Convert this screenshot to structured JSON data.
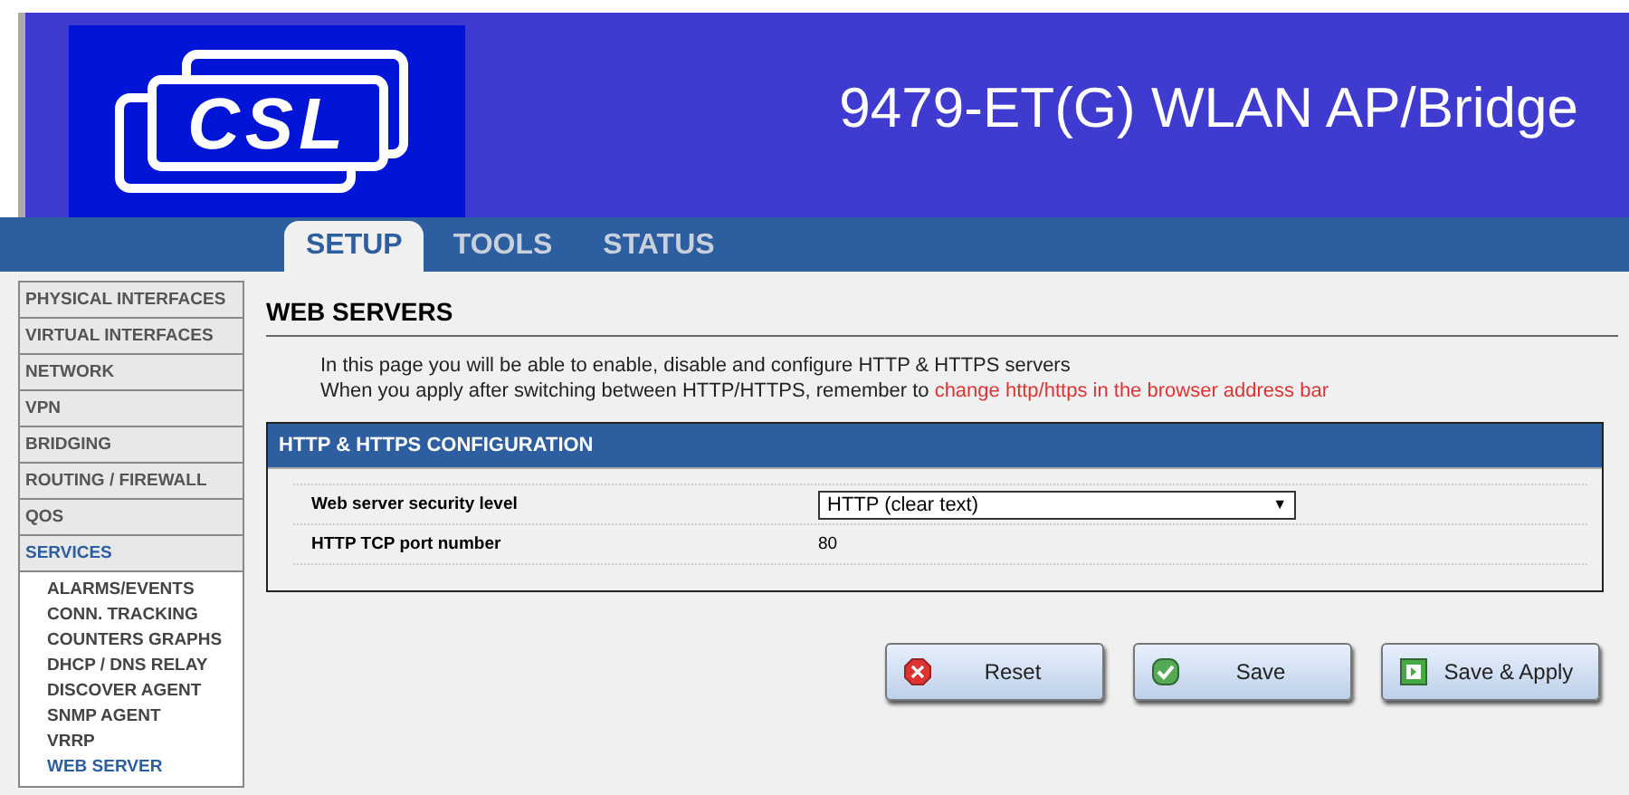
{
  "header": {
    "logo": "CSL",
    "title": "9479-ET(G) WLAN AP/Bridge"
  },
  "tabs": [
    {
      "label": "SETUP",
      "selected": true
    },
    {
      "label": "TOOLS",
      "selected": false
    },
    {
      "label": "STATUS",
      "selected": false
    }
  ],
  "sidebar": {
    "items": [
      {
        "label": "PHYSICAL INTERFACES",
        "selected": false
      },
      {
        "label": "VIRTUAL INTERFACES",
        "selected": false
      },
      {
        "label": "NETWORK",
        "selected": false
      },
      {
        "label": "VPN",
        "selected": false
      },
      {
        "label": "BRIDGING",
        "selected": false
      },
      {
        "label": "ROUTING / FIREWALL",
        "selected": false
      },
      {
        "label": "QOS",
        "selected": false
      },
      {
        "label": "SERVICES",
        "selected": true,
        "children": [
          {
            "label": "ALARMS/EVENTS",
            "selected": false
          },
          {
            "label": "CONN. TRACKING",
            "selected": false
          },
          {
            "label": "COUNTERS GRAPHS",
            "selected": false
          },
          {
            "label": "DHCP / DNS RELAY",
            "selected": false
          },
          {
            "label": "DISCOVER AGENT",
            "selected": false
          },
          {
            "label": "SNMP AGENT",
            "selected": false
          },
          {
            "label": "VRRP",
            "selected": false
          },
          {
            "label": "WEB SERVER",
            "selected": true
          }
        ]
      }
    ]
  },
  "page": {
    "title": "WEB SERVERS",
    "intro": "In this page you will be able to enable, disable and configure HTTP & HTTPS servers",
    "note": "When you apply after switching between HTTP/HTTPS, remember to",
    "note_link": "change http/https in the browser address bar"
  },
  "panel": {
    "title": "HTTP & HTTPS CONFIGURATION",
    "rows": [
      {
        "kind": "select",
        "label": "Web server security level",
        "value": "HTTP (clear text)",
        "arrow": "▼"
      },
      {
        "kind": "text",
        "label": "HTTP TCP port number",
        "value": "80"
      }
    ]
  },
  "buttons": [
    {
      "kind": "reset",
      "label": "Reset"
    },
    {
      "kind": "save",
      "label": "Save"
    },
    {
      "kind": "apply",
      "label": "Save & Apply"
    }
  ]
}
